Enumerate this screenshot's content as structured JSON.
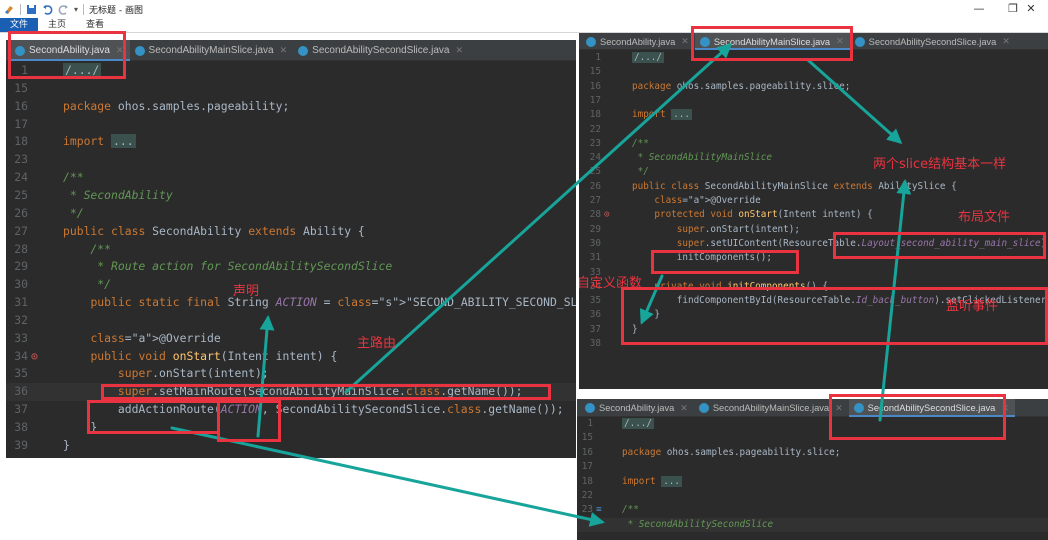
{
  "window": {
    "title": "无标题 - 画图",
    "ribbon_tabs": [
      "文件",
      "主页",
      "查看"
    ],
    "controls": {
      "minimize": "—",
      "maximize": "❐",
      "close": "✕"
    }
  },
  "colors": {
    "annotation": "#ea3340",
    "arrow": "#17a49a",
    "editor_bg": "#2b2b2b",
    "tab_bar_bg": "#3c3f41",
    "active_tab_indicator": "#4a88c7"
  },
  "left_editor": {
    "tabs": [
      "SecondAbility.java",
      "SecondAbilityMainSlice.java",
      "SecondAbilitySecondSlice.java"
    ],
    "lines": [
      {
        "n": "1",
        "t": "/.../"
      },
      {
        "n": "15",
        "t": ""
      },
      {
        "n": "16",
        "t": "package ohos.samples.pageability;"
      },
      {
        "n": "17",
        "t": ""
      },
      {
        "n": "18",
        "t": "import ..."
      },
      {
        "n": "23",
        "t": ""
      },
      {
        "n": "24",
        "t": "/**"
      },
      {
        "n": "25",
        "t": " * SecondAbility"
      },
      {
        "n": "26",
        "t": " */"
      },
      {
        "n": "27",
        "t": "public class SecondAbility extends Ability {"
      },
      {
        "n": "28",
        "t": "    /**"
      },
      {
        "n": "29",
        "t": "     * Route action for SecondAbilitySecondSlice"
      },
      {
        "n": "30",
        "t": "     */"
      },
      {
        "n": "31",
        "t": "    public static final String ACTION = \"SECOND_ABILITY_SECOND_SLICE_ACTION\";"
      },
      {
        "n": "32",
        "t": ""
      },
      {
        "n": "33",
        "t": "    @Override"
      },
      {
        "n": "34",
        "t": "    public void onStart(Intent intent) {"
      },
      {
        "n": "35",
        "t": "        super.onStart(intent);"
      },
      {
        "n": "36",
        "t": "        super.setMainRoute(SecondAbilityMainSlice.class.getName());"
      },
      {
        "n": "37",
        "t": "        addActionRoute(ACTION, SecondAbilitySecondSlice.class.getName());"
      },
      {
        "n": "38",
        "t": "    }"
      },
      {
        "n": "39",
        "t": "}"
      }
    ]
  },
  "right_top_editor": {
    "tabs": [
      "SecondAbility.java",
      "SecondAbilityMainSlice.java",
      "SecondAbilitySecondSlice.java"
    ],
    "lines": [
      {
        "n": "1",
        "t": "/.../"
      },
      {
        "n": "15",
        "t": ""
      },
      {
        "n": "16",
        "t": "package ohos.samples.pageability.slice;"
      },
      {
        "n": "17",
        "t": ""
      },
      {
        "n": "18",
        "t": "import ..."
      },
      {
        "n": "22",
        "t": ""
      },
      {
        "n": "23",
        "t": "/**"
      },
      {
        "n": "24",
        "t": " * SecondAbilityMainSlice"
      },
      {
        "n": "25",
        "t": " */"
      },
      {
        "n": "26",
        "t": "public class SecondAbilityMainSlice extends AbilitySlice {"
      },
      {
        "n": "27",
        "t": "    @Override"
      },
      {
        "n": "28",
        "t": "    protected void onStart(Intent intent) {"
      },
      {
        "n": "29",
        "t": "        super.onStart(intent);"
      },
      {
        "n": "30",
        "t": "        super.setUIContent(ResourceTable.Layout_second_ability_main_slice);"
      },
      {
        "n": "31",
        "t": "        initComponents();"
      },
      {
        "n": "33",
        "t": ""
      },
      {
        "n": "34",
        "t": "    private void initComponents() {"
      },
      {
        "n": "35",
        "t": "        findComponentById(ResourceTable.Id_back_button).setClickedListener("
      },
      {
        "n": "36",
        "t": "    }"
      },
      {
        "n": "37",
        "t": "}"
      },
      {
        "n": "38",
        "t": ""
      }
    ]
  },
  "right_bottom_editor": {
    "tabs": [
      "SecondAbility.java",
      "SecondAbilityMainSlice.java",
      "SecondAbilitySecondSlice.java"
    ],
    "lines": [
      {
        "n": "1",
        "t": "/.../"
      },
      {
        "n": "15",
        "t": ""
      },
      {
        "n": "16",
        "t": "package ohos.samples.pageability.slice;"
      },
      {
        "n": "17",
        "t": ""
      },
      {
        "n": "18",
        "t": "import ..."
      },
      {
        "n": "22",
        "t": ""
      },
      {
        "n": "23",
        "t": "/**"
      },
      {
        "n": "",
        "t": " * SecondAbilitySecondSlice"
      }
    ]
  },
  "annotations": {
    "declare": "声明",
    "main_route": "主路由",
    "same_structure": "两个slice结构基本一样",
    "layout_file": "布局文件",
    "custom_function": "自定义函数",
    "listener": "监听事件"
  }
}
